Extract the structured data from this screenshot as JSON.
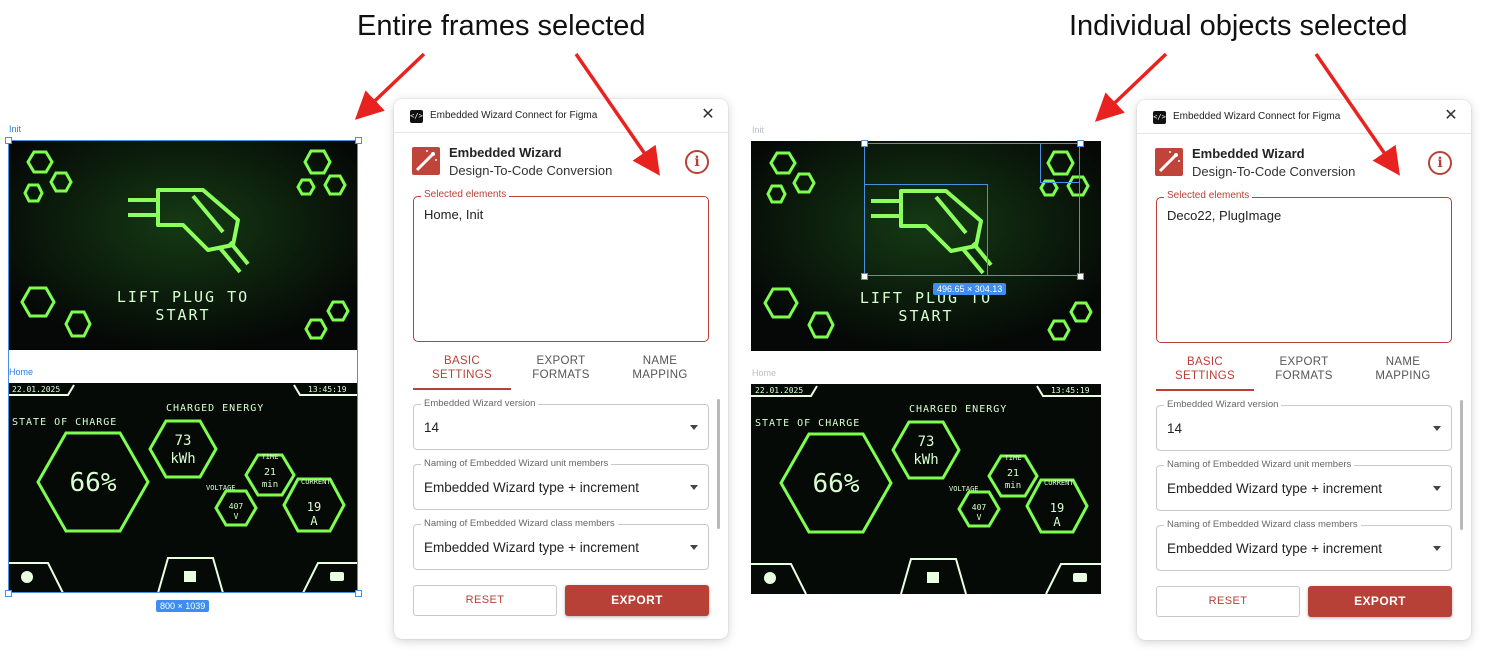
{
  "headings": {
    "left": "Entire frames selected",
    "right": "Individual objects selected"
  },
  "left_canvas": {
    "frame_init_label": "Init",
    "frame_home_label": "Home",
    "dimension_badge": "800 × 1039"
  },
  "right_canvas": {
    "frame_init_label": "Init",
    "frame_home_label": "Home",
    "dimension_badge": "496.65 × 304.13"
  },
  "init_screen": {
    "line1": "LIFT PLUG TO",
    "line2": "START"
  },
  "home_screen": {
    "date": "22.01.2025",
    "time": "13:45:19",
    "state_of_charge_label": "STATE OF CHARGE",
    "state_of_charge_value": "66%",
    "charged_energy_label": "CHARGED ENERGY",
    "energy_value": "73",
    "energy_unit": "kWh",
    "time_label": "TIME",
    "time_value": "21",
    "time_unit": "min",
    "voltage_label": "VOLTAGE",
    "voltage_value": "407",
    "voltage_unit": "V",
    "current_label": "CURRENT",
    "current_value": "19",
    "current_unit": "A"
  },
  "panel_left": {
    "plugin_title": "Embedded Wizard Connect for Figma",
    "brand_title": "Embedded Wizard",
    "brand_subtitle": "Design-To-Code Conversion",
    "selected_label": "Selected elements",
    "selected_value": "Home, Init",
    "tabs": [
      {
        "line1": "BASIC",
        "line2": "SETTINGS"
      },
      {
        "line1": "EXPORT",
        "line2": "FORMATS"
      },
      {
        "line1": "NAME",
        "line2": "MAPPING"
      }
    ],
    "version_label": "Embedded Wizard version",
    "version_value": "14",
    "unit_members_label": "Naming of Embedded Wizard unit members",
    "unit_members_value": "Embedded Wizard type + increment",
    "class_members_label": "Naming of Embedded Wizard class members",
    "class_members_value": "Embedded Wizard type + increment",
    "reset_label": "RESET",
    "export_label": "EXPORT"
  },
  "panel_right": {
    "plugin_title": "Embedded Wizard Connect for Figma",
    "brand_title": "Embedded Wizard",
    "brand_subtitle": "Design-To-Code Conversion",
    "selected_label": "Selected elements",
    "selected_value": "Deco22, PlugImage",
    "tabs": [
      {
        "line1": "BASIC",
        "line2": "SETTINGS"
      },
      {
        "line1": "EXPORT",
        "line2": "FORMATS"
      },
      {
        "line1": "NAME",
        "line2": "MAPPING"
      }
    ],
    "version_label": "Embedded Wizard version",
    "version_value": "14",
    "unit_members_label": "Naming of Embedded Wizard unit members",
    "unit_members_value": "Embedded Wizard type + increment",
    "class_members_label": "Naming of Embedded Wizard class members",
    "class_members_value": "Embedded Wizard type + increment",
    "reset_label": "RESET",
    "export_label": "EXPORT"
  },
  "colors": {
    "accent": "#b84137",
    "arrow": "#e8231f",
    "selection": "#4a90e2",
    "neon_green": "#6cff3a",
    "screen_bg": "#050806"
  }
}
